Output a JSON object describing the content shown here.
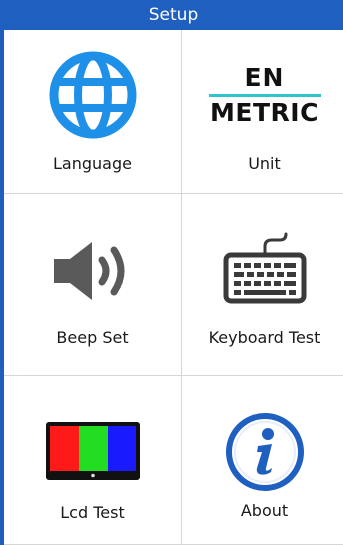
{
  "header": {
    "title": "Setup"
  },
  "menu": {
    "items": [
      {
        "label": "Language",
        "icon": "globe-icon"
      },
      {
        "label": "Unit",
        "icon": "unit-icon",
        "icon_text_top": "EN",
        "icon_text_bottom": "METRIC"
      },
      {
        "label": "Beep Set",
        "icon": "speaker-icon"
      },
      {
        "label": "Keyboard Test",
        "icon": "keyboard-icon"
      },
      {
        "label": "Lcd Test",
        "icon": "lcd-color-bars-icon"
      },
      {
        "label": "About",
        "icon": "info-icon"
      }
    ]
  },
  "colors": {
    "header_bg": "#1f5fc0",
    "globe_blue": "#1e90e8",
    "unit_underline": "#2ec4d0",
    "info_blue": "#1f5fc0",
    "lcd_red": "#ff1a1a",
    "lcd_green": "#22dd22",
    "lcd_blue": "#1a1aff",
    "icon_gray": "#5a5a5a"
  }
}
